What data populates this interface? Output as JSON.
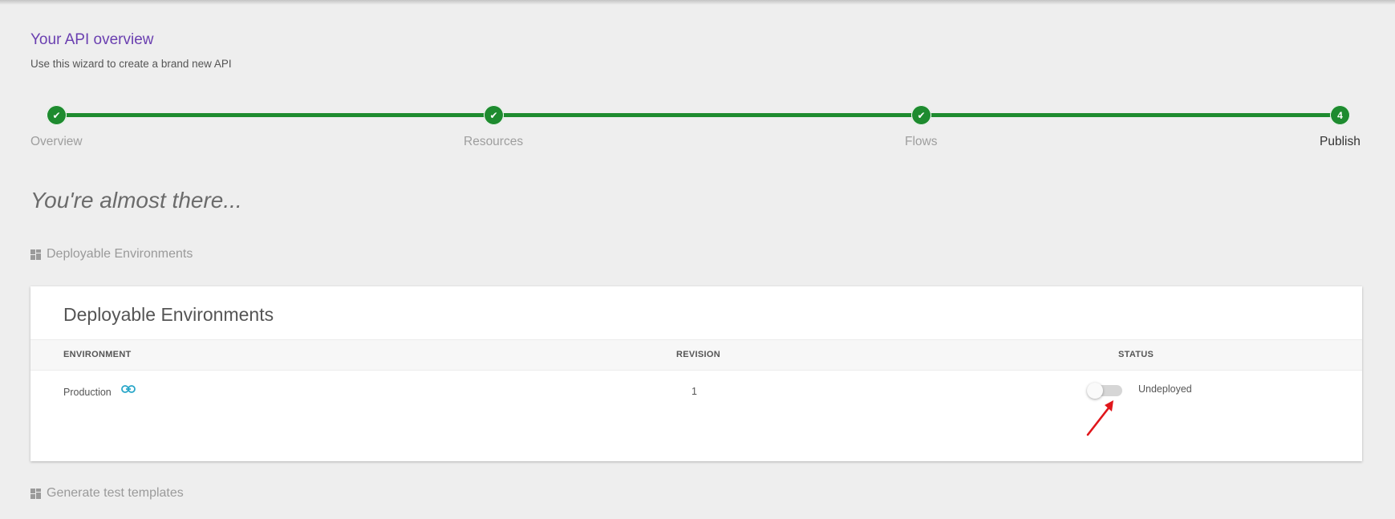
{
  "header": {
    "title": "Your API overview",
    "subtitle": "Use this wizard to create a brand new API"
  },
  "stepper": {
    "steps": [
      {
        "label": "Overview",
        "marker": "✔",
        "state": "complete"
      },
      {
        "label": "Resources",
        "marker": "✔",
        "state": "complete"
      },
      {
        "label": "Flows",
        "marker": "✔",
        "state": "complete"
      },
      {
        "label": "Publish",
        "marker": "4",
        "state": "active"
      }
    ],
    "color": "#1e8b2f"
  },
  "main": {
    "heading": "You're almost there...",
    "sections": [
      {
        "label": "Deployable Environments",
        "icon": "dashboard-icon"
      },
      {
        "label": "Generate test templates",
        "icon": "dashboard-icon"
      }
    ]
  },
  "card": {
    "title": "Deployable Environments",
    "columns": [
      "ENVIRONMENT",
      "REVISION",
      "STATUS"
    ],
    "rows": [
      {
        "environment": "Production",
        "environment_icon": "link-icon",
        "revision": "1",
        "status": "Undeployed",
        "deployed": false
      }
    ]
  },
  "annotation": {
    "icon": "red-arrow-icon",
    "color": "#e0161b"
  }
}
